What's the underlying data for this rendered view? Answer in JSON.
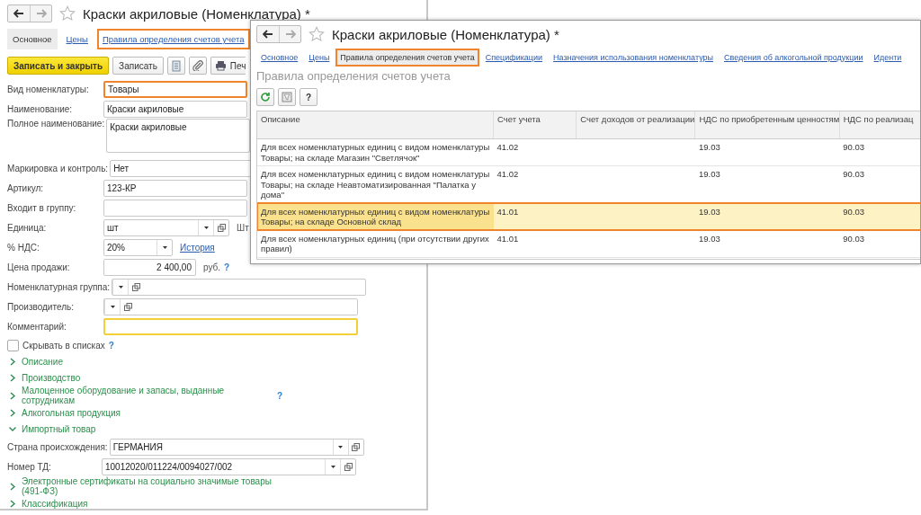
{
  "form_window": {
    "title": "Краски акриловые (Номенклатура) *",
    "tabs": [
      {
        "label": "Основное",
        "selected": true,
        "highlighted": false
      },
      {
        "label": "Цены",
        "selected": false,
        "highlighted": false
      },
      {
        "label": "Правила определения счетов учета",
        "selected": false,
        "highlighted": true
      }
    ],
    "toolbar": {
      "save_close": "Записать и закрыть",
      "save": "Записать",
      "print": "Печ"
    },
    "fields": [
      {
        "label": "Вид номенклатуры:",
        "value": "Товары",
        "kind": "text",
        "highlighted": true,
        "focused": false
      },
      {
        "label": "Наименование:",
        "value": "Краски акриловые",
        "kind": "text",
        "highlighted": false,
        "focused": false
      },
      {
        "label": "Полное наименование:",
        "value": "Краски акриловые",
        "kind": "memo",
        "highlighted": false,
        "focused": false
      },
      {
        "label": "Маркировка и контроль:",
        "value": "Нет",
        "kind": "text",
        "highlighted": false,
        "focused": false
      },
      {
        "label": "Артикул:",
        "value": "123-КР",
        "kind": "text",
        "highlighted": false,
        "focused": false
      },
      {
        "label": "Входит в группу:",
        "kind": "text",
        "highlighted": false,
        "focused": false
      },
      {
        "label": "Единица:",
        "value": "шт",
        "kind": "select",
        "highlighted": false,
        "focused": false,
        "after": [
          {
            "kind": "text",
            "text": "Шт"
          }
        ]
      },
      {
        "label": "% НДС:",
        "value": "20%",
        "kind": "combo",
        "highlighted": false,
        "focused": false,
        "after": [
          {
            "kind": "link",
            "text": "История"
          }
        ]
      },
      {
        "label": "Цена продажи:",
        "value": "2 400,00",
        "kind": "amount",
        "highlighted": false,
        "focused": false,
        "after": [
          {
            "kind": "text",
            "text": "руб."
          },
          {
            "kind": "help",
            "text": "?"
          }
        ]
      },
      {
        "label": "Номенклатурная группа:",
        "kind": "select",
        "highlighted": false,
        "focused": false
      },
      {
        "label": "Производитель:",
        "kind": "select",
        "highlighted": false,
        "focused": false
      },
      {
        "label": "Комментарий:",
        "kind": "text",
        "highlighted": false,
        "focused": true
      }
    ],
    "hide_in_lists": {
      "label": "Скрывать в списках",
      "checked": false,
      "help": "?"
    },
    "groups": [
      {
        "label": "Описание",
        "expanded": false
      },
      {
        "label": "Производство",
        "expanded": false
      },
      {
        "label": "Малоценное оборудование и запасы, выданные сотрудникам",
        "expanded": false,
        "help": "?"
      },
      {
        "label": "Алкогольная продукция",
        "expanded": false
      },
      {
        "label": "Импортный товар",
        "expanded": true,
        "fields": [
          {
            "label": "Страна происхождения:",
            "value": "ГЕРМАНИЯ",
            "kind": "select"
          },
          {
            "label": "Номер ТД:",
            "value": "10012020/011224/0094027/002",
            "kind": "select"
          }
        ]
      },
      {
        "label": "Электронные сертификаты на социально значимые товары (491-ФЗ)",
        "expanded": false
      },
      {
        "label": "Классификация",
        "expanded": false
      }
    ]
  },
  "rules_window": {
    "title": "Краски акриловые (Номенклатура) *",
    "tabs": [
      {
        "label": "Основное",
        "selected": false,
        "highlighted": false
      },
      {
        "label": "Цены",
        "selected": false,
        "highlighted": false
      },
      {
        "label": "Правила определения счетов учета",
        "selected": true,
        "highlighted": true
      },
      {
        "label": "Спецификации",
        "selected": false,
        "highlighted": false
      },
      {
        "label": "Назначения использования номенклатуры",
        "selected": false,
        "highlighted": false
      },
      {
        "label": "Сведения об алкогольной продукции",
        "selected": false,
        "highlighted": false
      },
      {
        "label": "Иденти",
        "selected": false,
        "highlighted": false
      }
    ],
    "section_title": "Правила определения счетов учета",
    "help_button": "?",
    "table": {
      "columns": [
        "Описание",
        "Счет учета",
        "Счет доходов от реализации",
        "НДС по приобретенным ценностям",
        "НДС по реализац"
      ],
      "rows": [
        {
          "cells": [
            "Для всех номенклатурных единиц с видом номенклатуры Товары; на складе Магазин \"Светлячок\"",
            "41.02",
            "",
            "19.03",
            "90.03"
          ],
          "selected": false,
          "highlighted": false
        },
        {
          "cells": [
            "Для всех номенклатурных единиц с видом номенклатуры Товары; на складе Неавтоматизированная \"Палатка у дома\"",
            "41.02",
            "",
            "19.03",
            "90.03"
          ],
          "selected": false,
          "highlighted": false
        },
        {
          "cells": [
            "Для всех номенклатурных единиц с видом номенклатуры Товары; на складе Основной склад",
            "41.01",
            "",
            "19.03",
            "90.03"
          ],
          "selected": true,
          "highlighted": true
        },
        {
          "cells": [
            "Для всех номенклатурных единиц (при отсутствии других правил)",
            "41.01",
            "",
            "19.03",
            "90.03"
          ],
          "selected": false,
          "highlighted": false
        }
      ]
    }
  }
}
